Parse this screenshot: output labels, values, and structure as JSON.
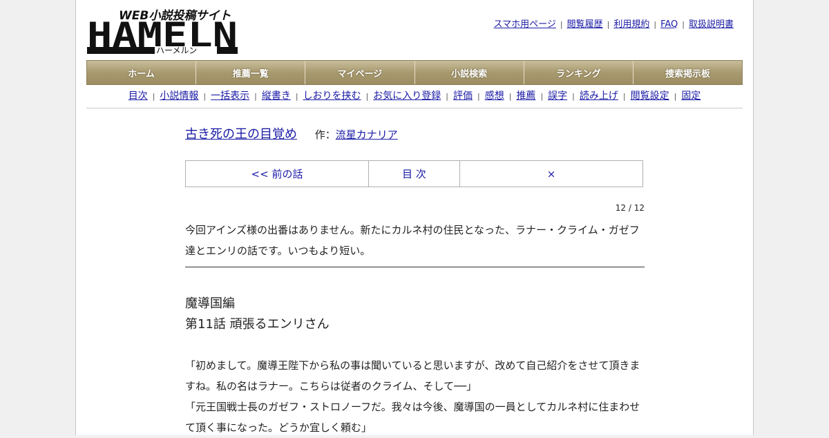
{
  "site": {
    "logo_tagline": "WEB小説投稿サイト",
    "logo_text": "HAMELN",
    "logo_kana": "ハーメルン"
  },
  "top_links": [
    "スマホ用ページ",
    "閲覧履歴",
    "利用規約",
    "FAQ",
    "取扱説明書"
  ],
  "nav": [
    "ホーム",
    "推薦一覧",
    "マイページ",
    "小説検索",
    "ランキング",
    "捜索掲示板"
  ],
  "sub_links": [
    "目次",
    "小説情報",
    "一括表示",
    "縦書き",
    "しおりを挟む",
    "お気に入り登録",
    "評価",
    "感想",
    "推薦",
    "誤字",
    "読み上げ",
    "閲覧設定",
    "固定"
  ],
  "novel": {
    "title": "古き死の王の目覚め",
    "author_prefix": "作：",
    "author": "流星カナリア"
  },
  "pager": {
    "prev": "<< 前の話",
    "toc": "目 次",
    "close": "×"
  },
  "counter": "12 / 12",
  "preface": "今回アインズ様の出番はありません。新たにカルネ村の住民となった、ラナー・クライム・ガゼフ達とエンリの話です。いつもより短い。",
  "chapter": {
    "arc": "魔導国編",
    "title": "第11話 頑張るエンリさん"
  },
  "body": [
    "「初めまして。魔導王陛下から私の事は聞いていると思いますが、改めて自己紹介をさせて頂きますね。私の名はラナー。こちらは従者のクライム、そして──」",
    "「元王国戦士長のガゼフ・ストロノーフだ。我々は今後、魔導国の一員としてカルネ村に住まわせて頂く事になった。どうか宜しく頼む」"
  ]
}
